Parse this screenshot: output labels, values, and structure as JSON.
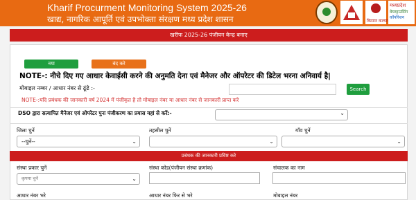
{
  "header": {
    "title_en": "Kharif Procurment Monitoring System 2025-26",
    "title_hi": "खाद्य, नागरिक आपूर्ति एवं उपभोक्ता संरक्षण मध्य प्रदेश शासन",
    "logo3_caption": "किसान कल्याण",
    "logo4_line1": "मध्यप्रदेश",
    "logo4_line2": "वेयरहाउसिंग",
    "logo4_line3": "कॉर्पोरेशन"
  },
  "title_bar": "खरीफ 2025-26 पंजीयन केन्द्र बनाए",
  "buttons": {
    "new": "नया",
    "close": "बंद करे",
    "search": "Search"
  },
  "note1": "NOTE-: नीचे दिए गए आधार केवाईसी करने की अनुमति देना एवं मैनेजर और ऑपरेटर की डिटेल भरना अनिवार्य है|",
  "mobile_label": "मोबाइल नम्बर / आधार नंबर से ढूंढे :-",
  "note2": "NOTE-:यदि प्रबंधक की जानकारी वर्ष 2024 में पंजीकृत है तो मोबाइल नंबर या आधार नंबर से जानकारी प्राप्त करे",
  "dso_label": "DSO द्वारा सत्यापित मैनेजर एवं ओपरेटर पुनः पंजीकरण का प्रयास यहां से करें:-",
  "location": {
    "district_label": "जिला चुनें",
    "district_value": "--चुनें--",
    "tehsil_label": "तहसील चुनें",
    "village_label": "गाँव चुनें"
  },
  "manager_bar": "प्रबंधक की जानकारी प्रविष्ट करे",
  "form": {
    "org_type_label": "संस्था प्रकार चुनें",
    "org_type_value": "कृपया चुनें",
    "org_code_label": "संस्था कोड(पंजीयन संस्था क्रमांक)",
    "director_label": "संचालक का नाम",
    "aadhaar_label": "आधार नंबर भरे",
    "aadhaar_again_label": "आधार नंबर फिर से भरे",
    "mobile_label": "मोबाइल नंबर"
  }
}
